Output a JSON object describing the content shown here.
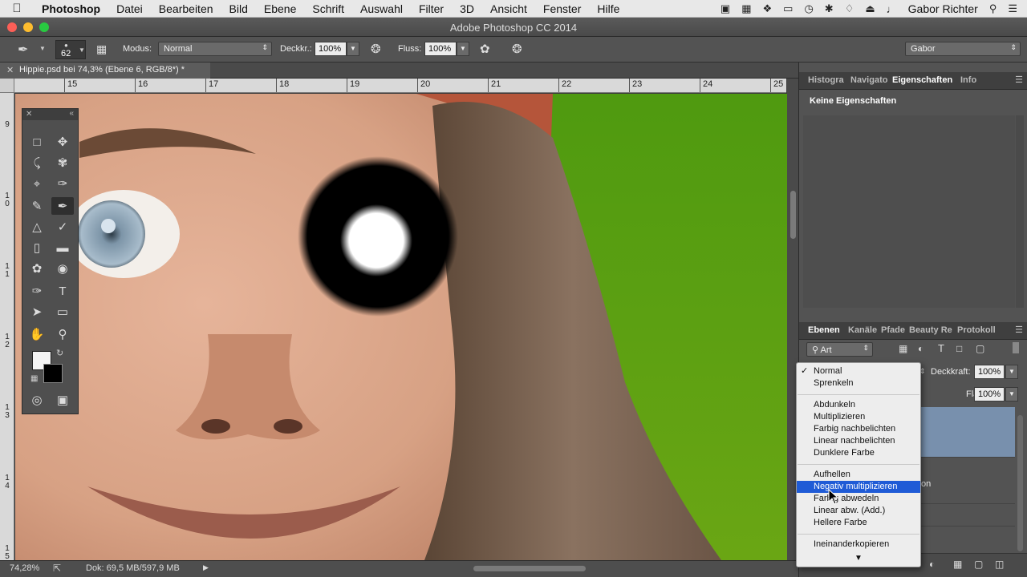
{
  "menubar": {
    "app": "Photoshop",
    "items": [
      "Datei",
      "Bearbeiten",
      "Bild",
      "Ebene",
      "Schrift",
      "Auswahl",
      "Filter",
      "3D",
      "Ansicht",
      "Fenster",
      "Hilfe"
    ],
    "user": "Gabor Richter"
  },
  "window": {
    "title": "Adobe Photoshop CC 2014"
  },
  "options": {
    "brush_size": "62",
    "modus_label": "Modus:",
    "modus_value": "Normal",
    "deckkr_label": "Deckkr.:",
    "deckkr_value": "100%",
    "fluss_label": "Fluss:",
    "fluss_value": "100%",
    "workspace": "Gabor"
  },
  "document": {
    "tab_title": "Hippie.psd bei 74,3% (Ebene 6, RGB/8*) *",
    "ruler_h": [
      "15",
      "16",
      "17",
      "18",
      "19",
      "20",
      "21",
      "22",
      "23",
      "24",
      "25"
    ],
    "ruler_v": [
      "9",
      "1\n0",
      "1\n1",
      "1\n2",
      "1\n3",
      "1\n4",
      "1\n5"
    ]
  },
  "status": {
    "zoom": "74,28%",
    "doc": "Dok: 69,5 MB/597,9 MB"
  },
  "panels": {
    "top_tabs": [
      "Histogra",
      "Navigato",
      "Eigenschaften",
      "Info"
    ],
    "properties_text": "Keine Eigenschaften",
    "layer_tabs": [
      "Ebenen",
      "Kanäle",
      "Pfade",
      "Beauty Re",
      "Protokoll"
    ],
    "filter_label": "Art",
    "deckkraft_label": "Deckkraft:",
    "deckkraft_value": "100%",
    "flaeche_label": "Fläche:",
    "flaeche_value": "100%",
    "partial_layer_text": "on"
  },
  "blend_menu": {
    "selected": "Normal",
    "highlighted": "Negativ multiplizieren",
    "groups": [
      [
        "Normal",
        "Sprenkeln"
      ],
      [
        "Abdunkeln",
        "Multiplizieren",
        "Farbig nachbelichten",
        "Linear nachbelichten",
        "Dunklere Farbe"
      ],
      [
        "Aufhellen",
        "Negativ multiplizieren",
        "Farbig abwedeln",
        "Linear abw. (Add.)",
        "Hellere Farbe"
      ],
      [
        "Ineinanderkopieren"
      ]
    ]
  },
  "colors": {
    "panel_bg": "#535353",
    "highlight": "#1f5bd6",
    "green_bg": "#5a9a12"
  }
}
